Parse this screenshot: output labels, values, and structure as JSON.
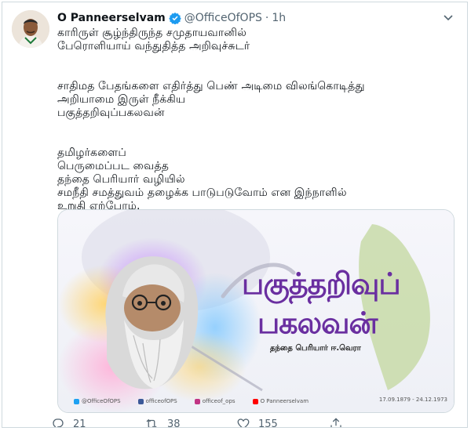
{
  "tweet": {
    "author_name": "O Panneerselvam",
    "handle": "@OfficeOfOPS",
    "separator": "·",
    "time": "1h",
    "lines": [
      "காரிருள் சூழ்ந்திருந்த சமுதாயவானில்",
      "பேரொளியாய் வந்துதித்த அறிவுச்சுடர்",
      "",
      "சாதிமத பேதங்களை எதிர்த்து பெண் அடிமை விலங்கொடித்து",
      "அறியாமை இருள் நீக்கிய",
      "பகுத்தறிவுப்பகலவன்",
      "",
      "தமிழர்களைப்",
      "பெருமைப்பட வைத்த",
      "தந்தை பெரியார் வழியில்",
      "சமநீதி சமத்துவம் தழைக்க பாடுபடுவோம் என இந்நாளில்",
      "உறுதி ஏற்போம்."
    ]
  },
  "media": {
    "title_line1": "பகுத்தறிவுப்",
    "title_line2": "பகலவன்",
    "subtitle": "தந்தை பெரியார் ஈ.வெரா",
    "dates": "17.09.1879 - 24.12.1973",
    "socials": [
      {
        "label": "@OfficeOfOPS",
        "color": "#1da1f2"
      },
      {
        "label": "officeofOPS",
        "color": "#3b5998"
      },
      {
        "label": "officeof_ops",
        "color": "#c13584"
      },
      {
        "label": "O Panneerselvam",
        "color": "#ff0000"
      }
    ],
    "title_color": "#6a2fa0",
    "map_color": "#c8dba8"
  },
  "actions": {
    "reply_count": "21",
    "retweet_count": "38",
    "like_count": "155"
  },
  "colors": {
    "verified": "#1d9bf0",
    "muted": "#536471",
    "border": "#cfd9de"
  }
}
